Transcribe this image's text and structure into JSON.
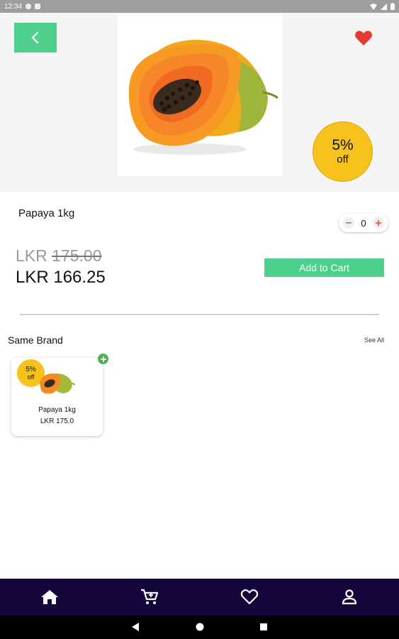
{
  "status_bar": {
    "time": "12:34"
  },
  "product": {
    "name": "Papaya 1kg",
    "quantity": "0",
    "currency": "LKR",
    "old_price": "175.00",
    "new_price": "LKR 166.25",
    "discount_pct": "5%",
    "discount_off": "off",
    "add_to_cart_label": "Add to Cart",
    "favorited": true
  },
  "same_brand": {
    "title": "Same Brand",
    "see_all_label": "See All",
    "items": [
      {
        "name": "Papaya 1kg",
        "price": "LKR 175.0",
        "discount_pct": "5%",
        "discount_off": "off"
      }
    ]
  },
  "colors": {
    "accent_green": "#4cd08c",
    "badge_yellow": "#f7c21c",
    "favorite_red": "#e53935",
    "nav_background": "#13063b"
  },
  "icons": {
    "back": "chevron-left-icon",
    "favorite": "heart-icon",
    "nav": [
      "home-icon",
      "cart-icon",
      "heart-outline-icon",
      "person-icon"
    ],
    "system": [
      "back-triangle-icon",
      "home-circle-icon",
      "recents-square-icon"
    ]
  }
}
